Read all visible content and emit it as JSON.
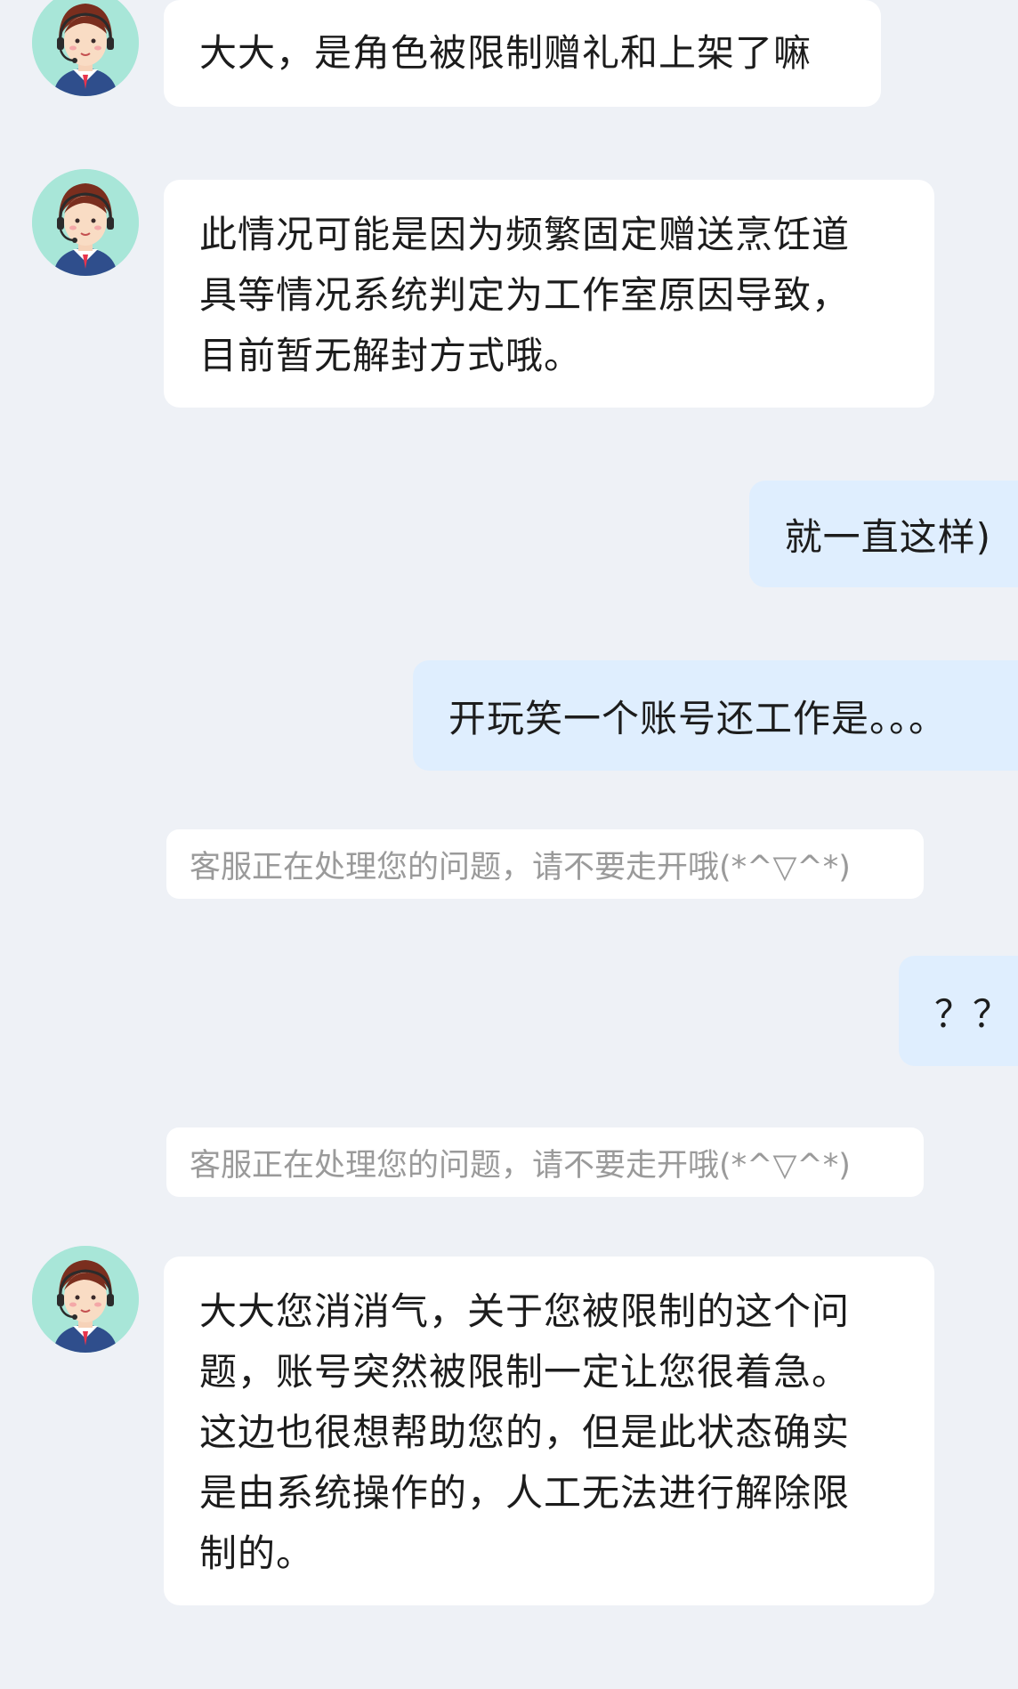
{
  "messages": {
    "agent_1": "大大，是角色被限制赠礼和上架了嘛",
    "agent_2": "此情况可能是因为频繁固定赠送烹饪道\n具等情况系统判定为工作室原因导致，\n目前暂无解封方式哦。",
    "user_1": "就一直这样)",
    "user_2": "开玩笑一个账号还工作是。。。",
    "system_1": "客服正在处理您的问题，请不要走开哦(*^▽^*)",
    "user_3": "？？",
    "system_2": "客服正在处理您的问题，请不要走开哦(*^▽^*)",
    "agent_3": "大大您消消气，关于您被限制的这个问\n题，账号突然被限制一定让您很着急。\n这边也很想帮助您的，但是此状态确实\n是由系统操作的，人工无法进行解除限\n制的。"
  },
  "icons": {
    "agent_avatar": "customer-service-agent-avatar"
  },
  "colors": {
    "background": "#eef1f6",
    "agent_bubble": "#ffffff",
    "user_bubble": "#dfeefe",
    "system_text": "#9a9a9a"
  }
}
